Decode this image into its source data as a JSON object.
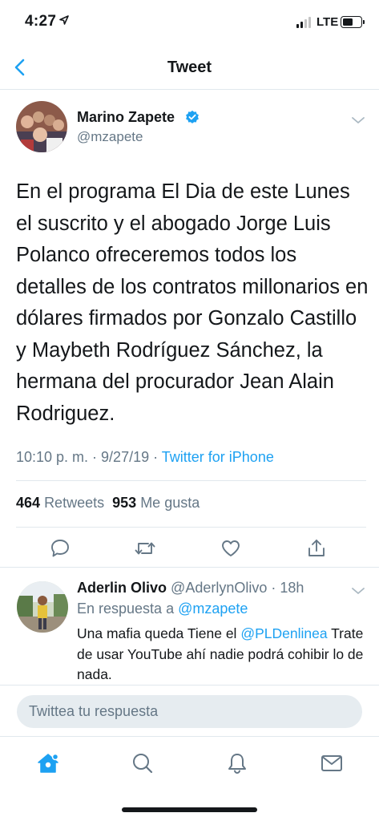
{
  "status_bar": {
    "time": "4:27",
    "network": "LTE"
  },
  "header": {
    "title": "Tweet"
  },
  "tweet": {
    "author_name": "Marino Zapete",
    "author_handle": "@mzapete",
    "text": "En el programa El Dia de este Lunes el suscrito y el abogado Jorge Luis Polanco ofreceremos todos los detalles de los contratos millonarios en dólares firmados por Gonzalo Castillo y Maybeth Rodríguez Sánchez, la hermana del procurador Jean Alain Rodriguez.",
    "timestamp": "10:10 p. m. · 9/27/19 · ",
    "source": "Twitter for iPhone",
    "retweets_count": "464",
    "retweets_label": "Retweets",
    "likes_count": "953",
    "likes_label": "Me gusta"
  },
  "reply": {
    "author_name": "Aderlin Olivo",
    "author_handle": "@AderlynOlivo",
    "time": "· 18h",
    "reply_to_label": "En respuesta a ",
    "reply_to_handle": "@mzapete",
    "text_before": "Una mafia queda Tiene el ",
    "mention": "@PLDenlinea",
    "text_after": " Trate de usar YouTube ahí nadie podrá cohibir lo de  nada."
  },
  "compose": {
    "placeholder": "Twittea tu respuesta"
  },
  "colors": {
    "accent": "#1da1f2",
    "secondary_text": "#657786",
    "divider": "#e1e8ed"
  },
  "icons": {
    "actions": [
      "reply-icon",
      "retweet-icon",
      "like-icon",
      "share-icon"
    ],
    "tabs": [
      "home-icon",
      "search-icon",
      "notifications-icon",
      "messages-icon"
    ]
  }
}
